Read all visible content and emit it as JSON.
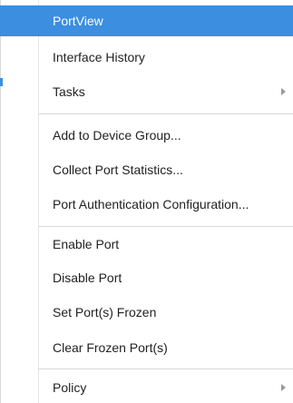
{
  "menu": {
    "items": [
      {
        "label": "PortView"
      },
      {
        "label": "Interface History"
      },
      {
        "label": "Tasks"
      },
      {
        "label": "Add to Device Group..."
      },
      {
        "label": "Collect Port Statistics..."
      },
      {
        "label": "Port Authentication Configuration..."
      },
      {
        "label": "Enable Port"
      },
      {
        "label": "Disable Port"
      },
      {
        "label": "Set Port(s) Frozen"
      },
      {
        "label": "Clear Frozen Port(s)"
      },
      {
        "label": "Policy"
      }
    ],
    "selected_item": "PortView",
    "colors": {
      "selection": "#3b8ee0",
      "text": "#222222",
      "separator": "#d9d9d9"
    },
    "icons": {
      "submenu": "chevron-right-icon"
    }
  }
}
